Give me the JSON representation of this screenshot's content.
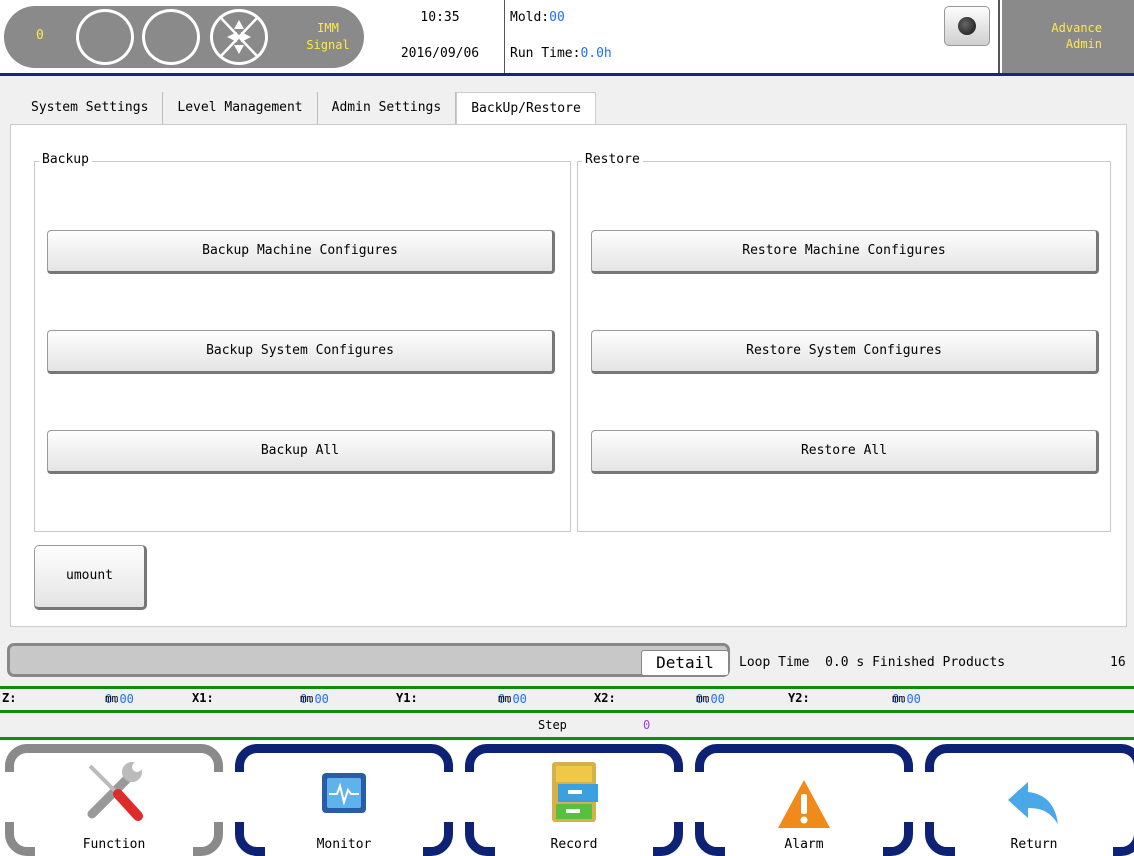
{
  "header": {
    "count": "0",
    "signal_line1": "IMM",
    "signal_line2": "Signal",
    "time": "10:35",
    "date": "2016/09/06",
    "mold_label": "Mold:",
    "mold_value": "00",
    "run_time_label": "Run Time:",
    "run_time_value": "0.0h",
    "user_line1": "Advance",
    "user_line2": "Admin"
  },
  "tabs": [
    {
      "label": "System Settings"
    },
    {
      "label": "Level Management"
    },
    {
      "label": "Admin Settings"
    },
    {
      "label": "BackUp/Restore",
      "active": true
    }
  ],
  "backup": {
    "title": "Backup",
    "buttons": [
      "Backup Machine Configures",
      "Backup System Configures",
      "Backup All"
    ]
  },
  "restore": {
    "title": "Restore",
    "buttons": [
      "Restore Machine Configures",
      "Restore System Configures",
      "Restore All"
    ]
  },
  "umount_label": "umount",
  "status": {
    "detail_label": "Detail",
    "loop_time_label": "Loop Time",
    "loop_time_value": "0.0 s",
    "finished_label": "Finished Products",
    "finished_value": "16"
  },
  "axes": [
    {
      "name": "Z:",
      "value": "0.00",
      "unit": "mm"
    },
    {
      "name": "X1:",
      "value": "0.00",
      "unit": "mm"
    },
    {
      "name": "Y1:",
      "value": "0.00",
      "unit": "mm"
    },
    {
      "name": "X2:",
      "value": "0.00",
      "unit": "mm"
    },
    {
      "name": "Y2:",
      "value": "0.00",
      "unit": "mm"
    }
  ],
  "step": {
    "label": "Step",
    "value": "0"
  },
  "nav": [
    {
      "label": "Function",
      "icon": "wrench-screwdriver-icon"
    },
    {
      "label": "Monitor",
      "icon": "monitor-icon"
    },
    {
      "label": "Record",
      "icon": "file-cabinet-icon"
    },
    {
      "label": "Alarm",
      "icon": "warning-icon"
    },
    {
      "label": "Return",
      "icon": "return-arrow-icon"
    }
  ],
  "colors": {
    "header_pill": "#8a8a8a",
    "header_text_accent": "#ffe94a",
    "value_blue": "#1e6fff",
    "nav_frame": "#0d2275",
    "status_line": "#138a13"
  }
}
